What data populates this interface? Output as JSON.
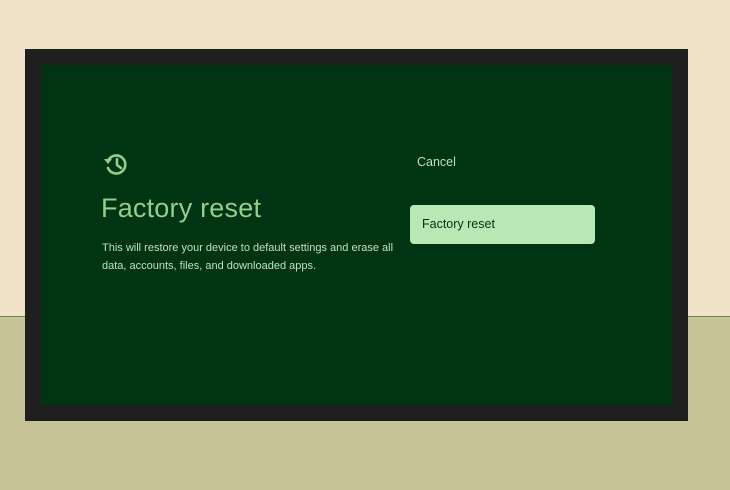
{
  "dialog": {
    "title": "Factory reset",
    "description": "This will restore your device to default settings and erase all data, accounts, files, and downloaded apps.",
    "icon": "restore-icon"
  },
  "actions": {
    "cancel_label": "Cancel",
    "confirm_label": "Factory reset",
    "focused": "confirm"
  },
  "colors": {
    "screen_background": "#013413",
    "accent": "#8fd18c",
    "focused_button": "#b8e9b4",
    "text_secondary": "#bfe0bb"
  }
}
